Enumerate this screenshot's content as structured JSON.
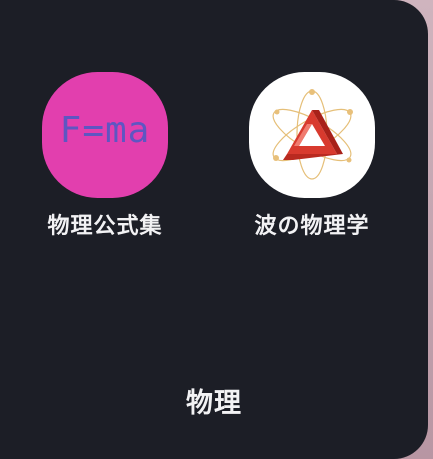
{
  "folder": {
    "name": "物理",
    "apps": [
      {
        "label": "物理公式集",
        "icon": "fma-formula-icon",
        "icon_text": "F=ma",
        "icon_bg": "#e23fae",
        "icon_text_color": "#5e56c2"
      },
      {
        "label": "波の物理学",
        "icon": "atom-penrose-triangle-icon",
        "icon_bg": "#ffffff",
        "accent": "#d83a2e"
      }
    ]
  },
  "colors": {
    "folder_bg": "#1c1e26",
    "label_text": "#f2f2f4",
    "wallpaper": "#c9a9b4"
  }
}
